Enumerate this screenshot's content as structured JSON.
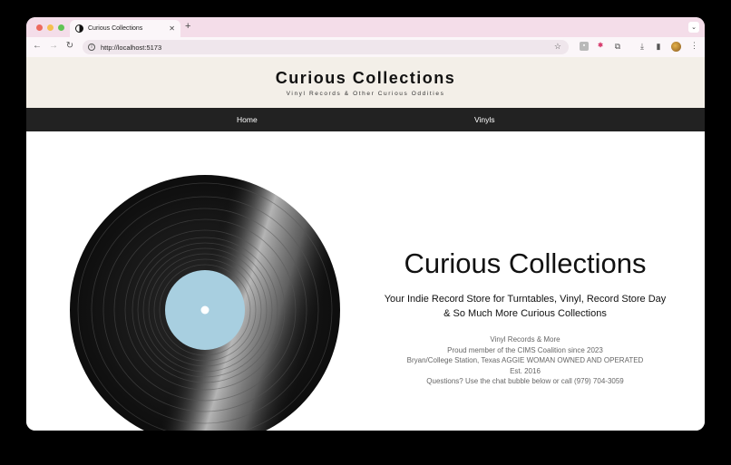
{
  "browser": {
    "tab_title": "Curious Collections",
    "url": "http://localhost:5173"
  },
  "site": {
    "title": "Curious Collections",
    "tagline": "Vinyl Records & Other Curious Oddities",
    "nav": [
      "Home",
      "Vinyls"
    ]
  },
  "hero": {
    "title": "Curious Collections",
    "subtitle": "Your Indie Record Store for Turntables, Vinyl, Record Store Day & So Much More Curious Collections",
    "info": [
      "Vinyl Records & More",
      "Proud member of the CIMS Coalition since 2023",
      "Bryan/College Station, Texas AGGIE WOMAN OWNED AND OPERATED",
      "Est. 2016",
      "Questions? Use the chat bubble below or call (979) 704-3059"
    ]
  },
  "colors": {
    "header_bg": "#f3efe8",
    "nav_bg": "#222222",
    "label": "#a8cfe0"
  }
}
